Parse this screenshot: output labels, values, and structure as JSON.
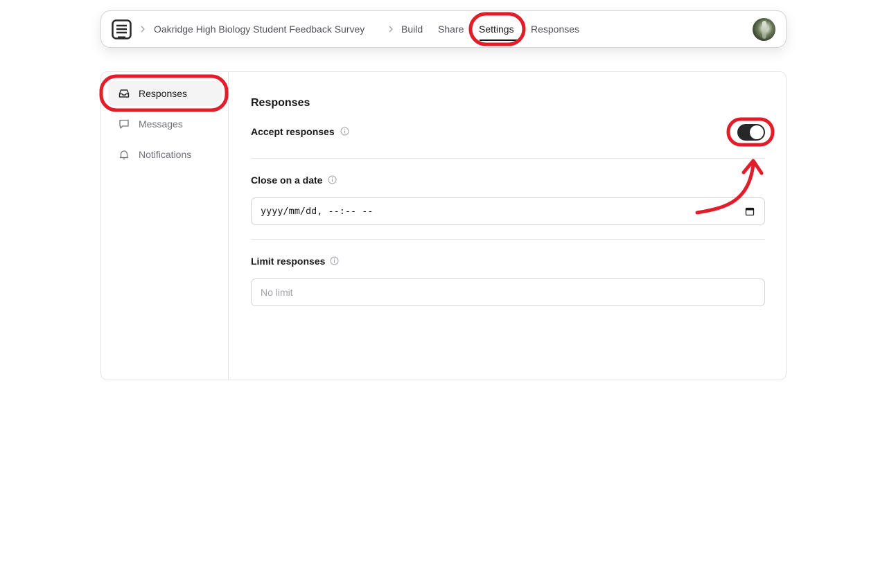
{
  "header": {
    "breadcrumb_form": "Oakridge High Biology Student Feedback Survey",
    "nav": [
      "Build",
      "Share",
      "Settings",
      "Responses"
    ],
    "active_nav": "Settings"
  },
  "sidebar": {
    "items": [
      {
        "label": "Responses",
        "icon": "inbox-icon",
        "active": true
      },
      {
        "label": "Messages",
        "icon": "message-icon",
        "active": false
      },
      {
        "label": "Notifications",
        "icon": "bell-icon",
        "active": false
      }
    ]
  },
  "main": {
    "title": "Responses",
    "accept_label": "Accept responses",
    "accept_enabled": true,
    "close_date_label": "Close on a date",
    "close_date_value": "yyyy/mm/dd, --:-- --",
    "limit_label": "Limit responses",
    "limit_placeholder": "No limit"
  },
  "colors": {
    "annotation": "#e11d2a",
    "toggle_on": "#27272a"
  }
}
